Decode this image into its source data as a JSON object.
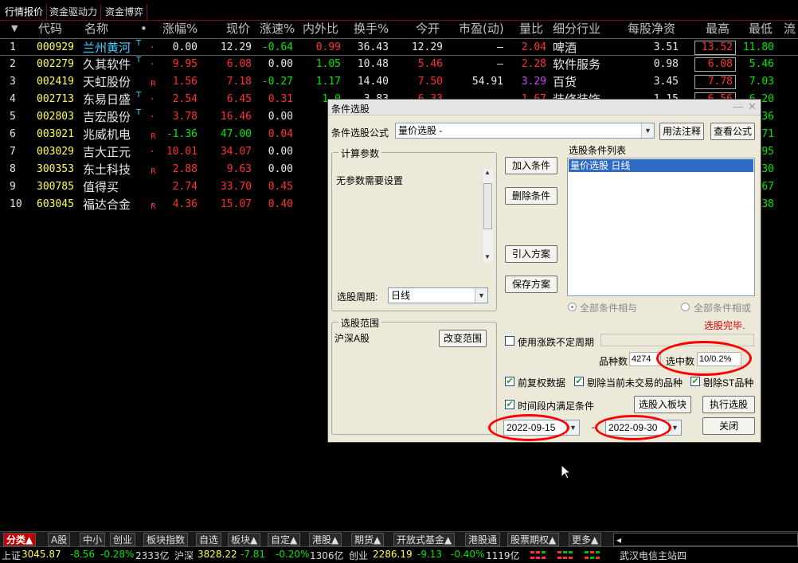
{
  "top_tabs": [
    "行情报价",
    "资金驱动力",
    "资金博弈"
  ],
  "table": {
    "headers": [
      "代码",
      "名称",
      "•",
      "涨幅%",
      "现价",
      "涨速%",
      "内外比",
      "换手%",
      "今开",
      "市盈(动)",
      "量比",
      "细分行业",
      "每股净资",
      "最高",
      "最低",
      "流"
    ],
    "rows": [
      {
        "no": "1",
        "code": "000929",
        "name": "兰州黄河",
        "tag": "T",
        "dot": "·",
        "flag": "",
        "chg": "0.00",
        "price": "12.29",
        "speed": "-0.64",
        "ratio": "0.99",
        "turnover": "36.43",
        "open": "12.29",
        "pe": "–",
        "vol_ratio": "2.04",
        "industry": "啤酒",
        "nav": "3.51",
        "high": "13.52",
        "low": "11.80"
      },
      {
        "no": "2",
        "code": "002279",
        "name": "久其软件",
        "tag": "T",
        "dot": "·",
        "flag": "",
        "chg": "9.95",
        "price": "6.08",
        "speed": "0.00",
        "ratio": "1.05",
        "turnover": "10.48",
        "open": "5.46",
        "pe": "–",
        "vol_ratio": "2.28",
        "industry": "软件服务",
        "nav": "0.98",
        "high": "6.08",
        "low": "5.46"
      },
      {
        "no": "3",
        "code": "002419",
        "name": "天虹股份",
        "tag": "",
        "dot": "",
        "flag": "R",
        "chg": "1.56",
        "price": "7.18",
        "speed": "-0.27",
        "ratio": "1.17",
        "turnover": "14.40",
        "open": "7.50",
        "pe": "54.91",
        "vol_ratio": "3.29",
        "industry": "百货",
        "nav": "3.45",
        "high": "7.78",
        "low": "7.03"
      },
      {
        "no": "4",
        "code": "002713",
        "name": "东易日盛",
        "tag": "T",
        "dot": "·",
        "flag": "",
        "chg": "2.54",
        "price": "6.45",
        "speed": "0.31",
        "ratio": "1.0",
        "turnover": "3.83",
        "open": "6.33",
        "pe": "",
        "vol_ratio": "1.67",
        "industry": "装修装饰",
        "nav": "1.15",
        "high": "6.56",
        "low": "6.20"
      },
      {
        "no": "5",
        "code": "002803",
        "name": "吉宏股份",
        "tag": "T",
        "dot": "·",
        "flag": "",
        "chg": "3.78",
        "price": "16.46",
        "speed": "0.00",
        "ratio": "0.",
        "turnover": "",
        "open": "",
        "pe": "",
        "vol_ratio": "",
        "industry": "",
        "nav": "",
        "high": "",
        "low": "36"
      },
      {
        "no": "6",
        "code": "003021",
        "name": "兆威机电",
        "tag": "",
        "dot": "",
        "flag": "R",
        "chg": "-1.36",
        "price": "47.00",
        "speed": "0.04",
        "ratio": "0.",
        "turnover": "",
        "open": "",
        "pe": "",
        "vol_ratio": "",
        "industry": "",
        "nav": "",
        "high": "",
        "low": "71"
      },
      {
        "no": "7",
        "code": "003029",
        "name": "吉大正元",
        "tag": "",
        "dot": "·",
        "flag": "",
        "chg": "10.01",
        "price": "34.07",
        "speed": "0.00",
        "ratio": "0.",
        "turnover": "",
        "open": "",
        "pe": "",
        "vol_ratio": "",
        "industry": "",
        "nav": "",
        "high": "",
        "low": "95"
      },
      {
        "no": "8",
        "code": "300353",
        "name": "东土科技",
        "tag": "",
        "dot": "",
        "flag": "R",
        "chg": "2.88",
        "price": "9.63",
        "speed": "0.00",
        "ratio": "0.",
        "turnover": "",
        "open": "",
        "pe": "",
        "vol_ratio": "",
        "industry": "",
        "nav": "",
        "high": "",
        "low": "30"
      },
      {
        "no": "9",
        "code": "300785",
        "name": "值得买",
        "tag": "",
        "dot": "",
        "flag": "",
        "chg": "2.74",
        "price": "33.70",
        "speed": "0.45",
        "ratio": "1.",
        "turnover": "",
        "open": "",
        "pe": "",
        "vol_ratio": "",
        "industry": "",
        "nav": "",
        "high": "",
        "low": "67"
      },
      {
        "no": "10",
        "code": "603045",
        "name": "福达合金",
        "tag": "",
        "dot": "·",
        "flag": "R",
        "chg": "4.36",
        "price": "15.07",
        "speed": "0.40",
        "ratio": "0.",
        "turnover": "",
        "open": "",
        "pe": "",
        "vol_ratio": "",
        "industry": "",
        "nav": "",
        "high": "",
        "low": "38"
      }
    ]
  },
  "dialog": {
    "title": "条件选股",
    "formula_label": "条件选股公式",
    "formula_value": "量价选股     -",
    "usage_btn": "用法注释",
    "view_formula_btn": "查看公式",
    "calc_params_title": "计算参数",
    "no_params": "无参数需要设置",
    "period_label": "选股周期:",
    "period_value": "日线",
    "add_cond": "加入条件",
    "del_cond": "删除条件",
    "import_plan": "引入方案",
    "save_plan": "保存方案",
    "cond_list_title": "选股条件列表",
    "cond_list_item": "量价选股  日线",
    "radio_and": "全部条件相与",
    "radio_or": "全部条件相或",
    "done": "选股完毕.",
    "range_title": "选股范围",
    "range_value": "沪深A股",
    "change_range": "改变范围",
    "use_period": "使用涨跌不定周期",
    "count_label": "品种数",
    "count_value": "4274",
    "selected_label": "选中数",
    "selected_value": "10/0.2%",
    "pre_adjust": "前复权数据",
    "exclude_untraded": "剔除当前未交易的品种",
    "exclude_st": "剔除ST品种",
    "time_range": "时间段内满足条件",
    "to_board": "选股入板块",
    "run": "执行选股",
    "date_from": "2022-09-15",
    "date_sep": "-",
    "date_to": "2022-09-30",
    "close": "关闭"
  },
  "bottom_tabs": [
    "分类▲",
    "A股",
    "中小",
    "创业",
    "板块指数",
    "自选",
    "板块▲",
    "自定▲",
    "港股▲",
    "期货▲",
    "开放式基金▲",
    "港股通",
    "股票期权▲",
    "更多▲"
  ],
  "status": {
    "sh_label": "上证",
    "sh_val": "3045.87",
    "sh_chg": "-8.56",
    "sh_pct": "-0.28%",
    "sh_amt": "2333亿",
    "sz_label": "沪深",
    "sz_val": "3828.22",
    "sz_chg": "-7.81",
    "sz_pct": "-0.20%",
    "sz_amt": "1306亿",
    "cy_label": "创业",
    "cy_val": "2286.19",
    "cy_chg": "-9.13",
    "cy_pct": "-0.40%",
    "cy_amt": "1119亿",
    "server": "武汉电信主站四"
  }
}
